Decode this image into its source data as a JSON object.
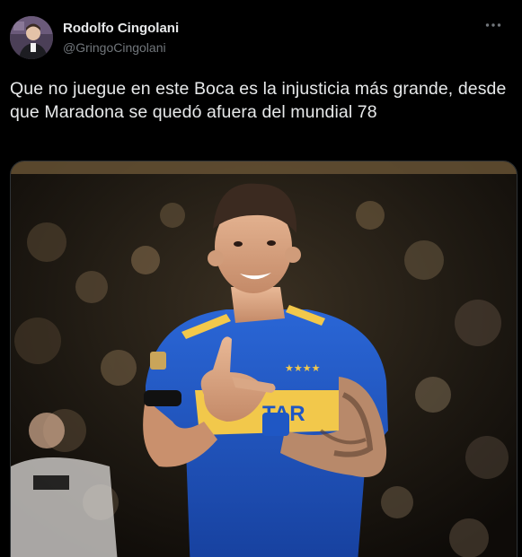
{
  "author": {
    "display_name": "Rodolfo Cingolani",
    "handle": "@GringoCingolani",
    "avatar": "avatar-photo"
  },
  "tweet": {
    "text": "Que no juegue en este Boca es la injusticia más grande, desde que Maradona se quedó afuera del mundial 78"
  },
  "media": {
    "shirt_text": "TAR",
    "stars": "★★★★",
    "description_colors": {
      "shirt_blue": "#1f57c4",
      "shirt_yellow": "#f2c84b",
      "background": "#1b1710"
    }
  },
  "icons": {
    "more": "more-options-icon"
  },
  "colors": {
    "background": "#000000",
    "text_primary": "#e7e9ea",
    "text_secondary": "#71767b"
  }
}
